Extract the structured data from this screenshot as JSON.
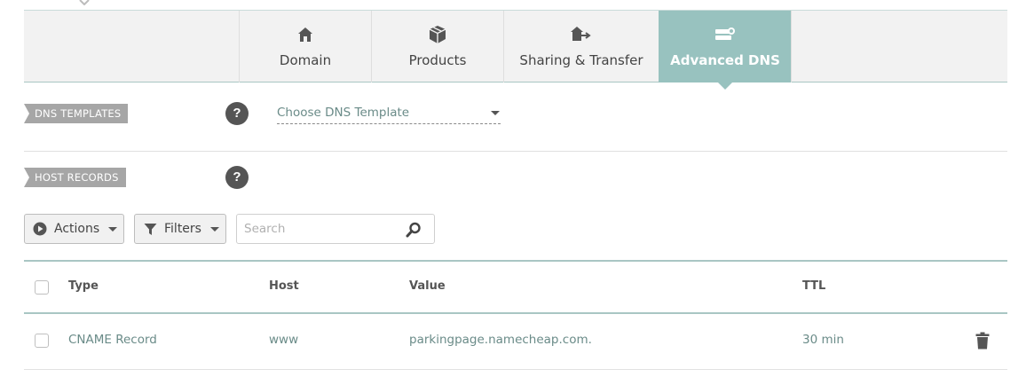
{
  "tabs": [
    {
      "label": "Domain",
      "icon": "home-icon"
    },
    {
      "label": "Products",
      "icon": "box-icon"
    },
    {
      "label": "Sharing & Transfer",
      "icon": "share-transfer-icon"
    },
    {
      "label": "Advanced DNS",
      "icon": "dns-server-icon",
      "active": true
    }
  ],
  "dns_templates": {
    "tag": "DNS TEMPLATES",
    "help": "?",
    "select_value": "Choose DNS Template"
  },
  "host_records": {
    "tag": "HOST RECORDS",
    "help": "?",
    "actions_label": "Actions",
    "filters_label": "Filters",
    "search_placeholder": "Search",
    "columns": {
      "type": "Type",
      "host": "Host",
      "value": "Value",
      "ttl": "TTL"
    },
    "rows": [
      {
        "type": "CNAME Record",
        "host": "www",
        "value": "parkingpage.namecheap.com.",
        "ttl": "30 min"
      }
    ]
  },
  "colors": {
    "accent": "#98c2bf",
    "tag_bg": "#a6a6a6",
    "link_text": "#6a8b88"
  }
}
